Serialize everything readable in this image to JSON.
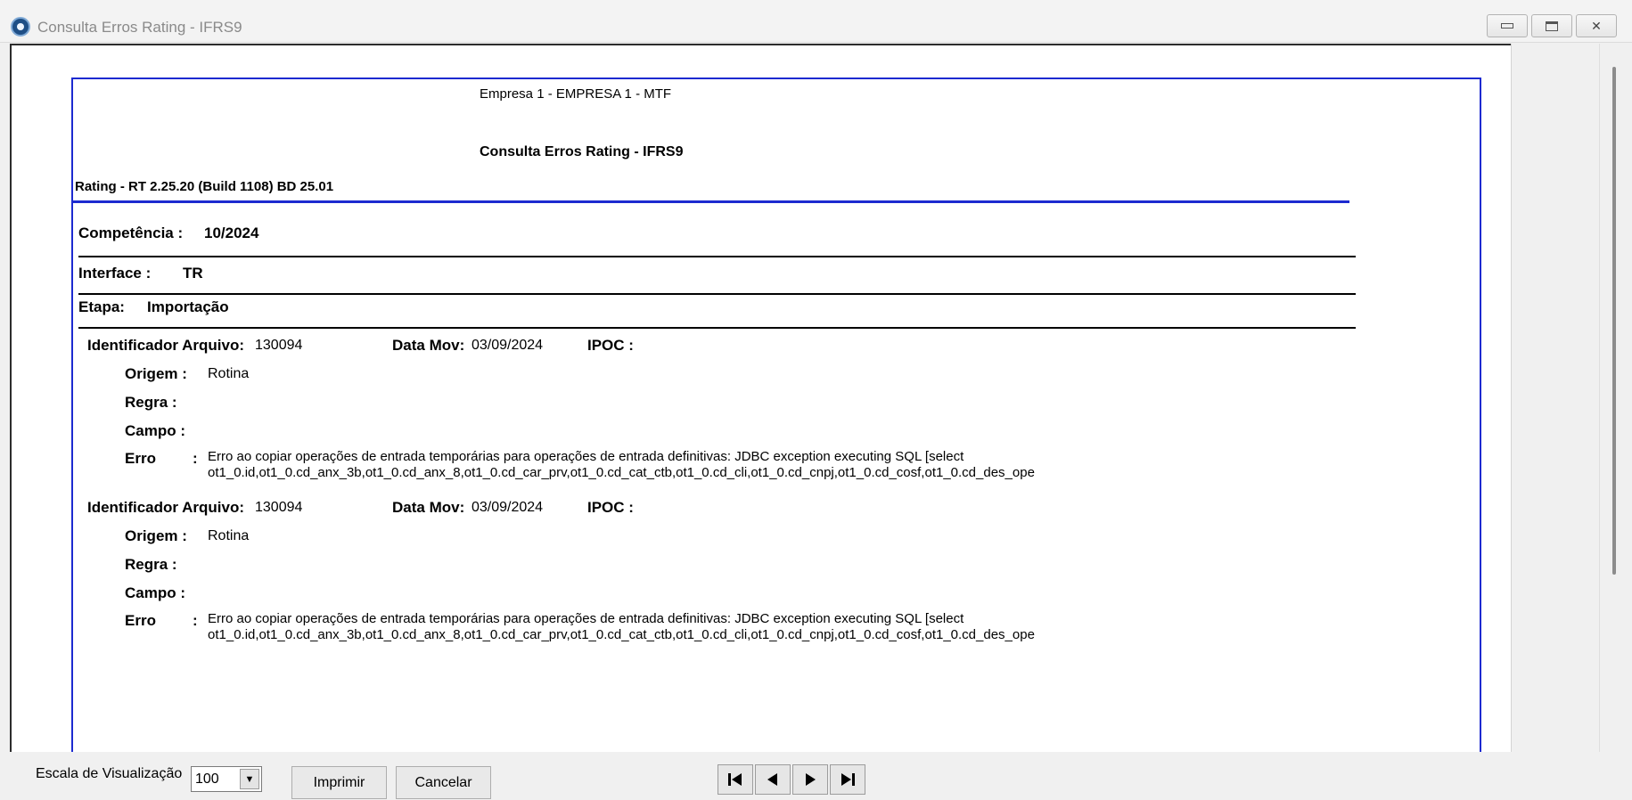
{
  "window": {
    "title": "Consulta Erros Rating - IFRS9",
    "icon": "app-icon"
  },
  "report": {
    "empresa": "Empresa  1 - EMPRESA 1 - MTF",
    "title": "Consulta Erros Rating - IFRS9",
    "version": "Rating - RT 2.25.20 (Build 1108) BD 25.01",
    "competencia_label": "Competência :",
    "competencia_value": "10/2024",
    "interface_label": "Interface :",
    "interface_value": "TR",
    "etapa_label": "Etapa:",
    "etapa_value": "Importação",
    "records": [
      {
        "ident_label": "Identificador Arquivo:",
        "ident_value": "130094",
        "datamov_label": "Data Mov:",
        "datamov_value": "03/09/2024",
        "ipoc_label": "IPOC :",
        "ipoc_value": "",
        "origem_label": "Origem :",
        "origem_value": "Rotina",
        "regra_label": "Regra  :",
        "regra_value": "",
        "campo_label": "Campo :",
        "campo_value": "",
        "erro_label": "Erro",
        "erro_colon": ":",
        "erro_line1": "Erro ao copiar operações de entrada temporárias para operações de entrada definitivas: JDBC exception executing SQL [select",
        "erro_line2": "ot1_0.id,ot1_0.cd_anx_3b,ot1_0.cd_anx_8,ot1_0.cd_car_prv,ot1_0.cd_cat_ctb,ot1_0.cd_cli,ot1_0.cd_cnpj,ot1_0.cd_cosf,ot1_0.cd_des_ope"
      },
      {
        "ident_label": "Identificador Arquivo:",
        "ident_value": "130094",
        "datamov_label": "Data Mov:",
        "datamov_value": "03/09/2024",
        "ipoc_label": "IPOC :",
        "ipoc_value": "",
        "origem_label": "Origem :",
        "origem_value": "Rotina",
        "regra_label": "Regra  :",
        "regra_value": "",
        "campo_label": "Campo :",
        "campo_value": "",
        "erro_label": "Erro",
        "erro_colon": ":",
        "erro_line1": "Erro ao copiar operações de entrada temporárias para operações de entrada definitivas: JDBC exception executing SQL [select",
        "erro_line2": "ot1_0.id,ot1_0.cd_anx_3b,ot1_0.cd_anx_8,ot1_0.cd_car_prv,ot1_0.cd_cat_ctb,ot1_0.cd_cli,ot1_0.cd_cnpj,ot1_0.cd_cosf,ot1_0.cd_des_ope"
      }
    ]
  },
  "footer": {
    "scale_label": "Escala de Visualização",
    "scale_value": "100",
    "print_label": "Imprimir",
    "cancel_label": "Cancelar",
    "nav": [
      "first-page-icon",
      "prev-page-icon",
      "next-page-icon",
      "last-page-icon"
    ]
  },
  "colors": {
    "page_border": "#1d2ad0",
    "window_bg": "#f0f0f0"
  }
}
